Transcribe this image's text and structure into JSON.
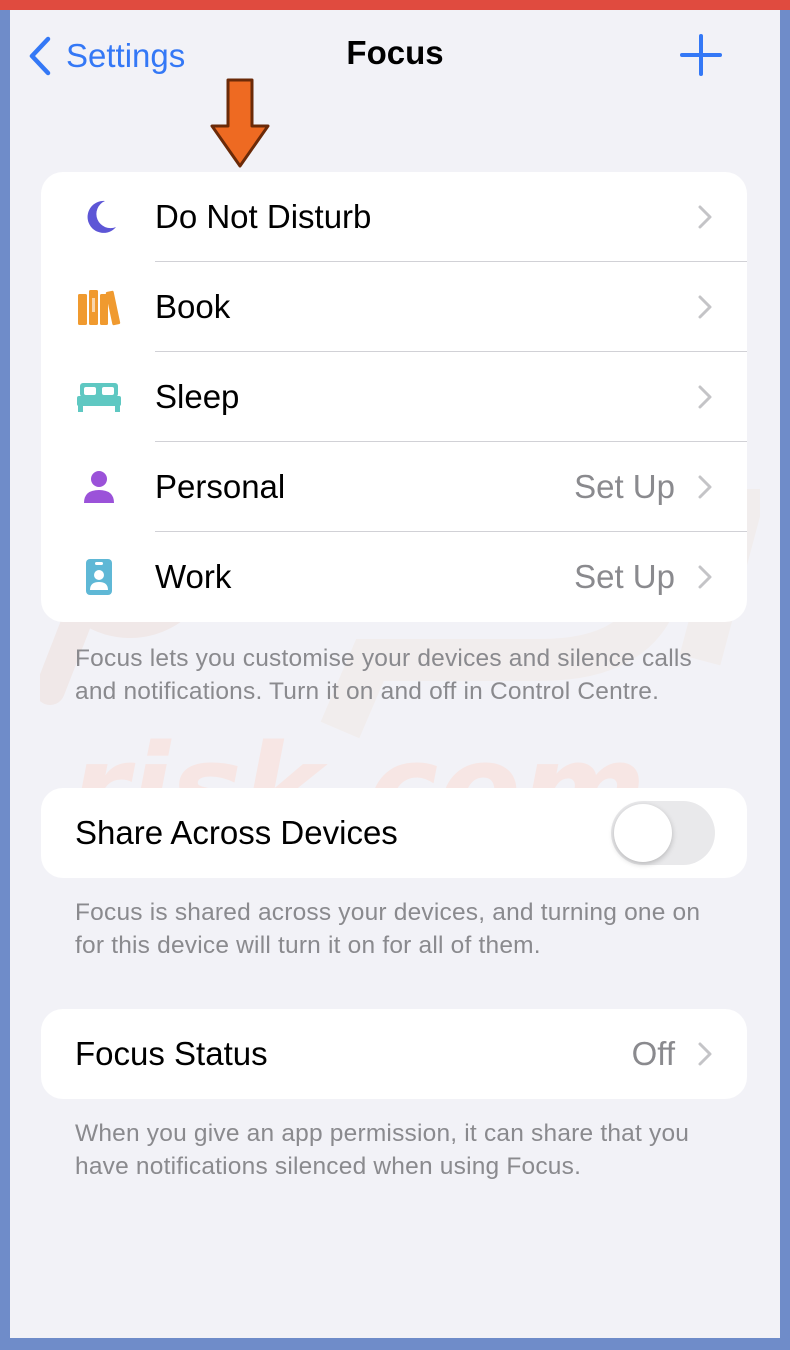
{
  "colors": {
    "accent": "#3478f6",
    "frame": "#6f8cc9",
    "status_strip": "#e04b3f",
    "annotation_arrow": "#ee6a22"
  },
  "nav": {
    "back_label": "Settings",
    "title": "Focus",
    "add_icon": "plus-icon"
  },
  "focus_modes": [
    {
      "label": "Do Not Disturb",
      "icon": "moon-icon",
      "value": "",
      "color": "#5d56d6"
    },
    {
      "label": "Book",
      "icon": "books-icon",
      "value": "",
      "color": "#f09a2f"
    },
    {
      "label": "Sleep",
      "icon": "bed-icon",
      "value": "",
      "color": "#5fc8c2"
    },
    {
      "label": "Personal",
      "icon": "person-icon",
      "value": "Set Up",
      "color": "#9b52d9"
    },
    {
      "label": "Work",
      "icon": "id-badge-icon",
      "value": "Set Up",
      "color": "#5fb8d6"
    }
  ],
  "focus_footnote": "Focus lets you customise your devices and silence calls and notifications. Turn it on and off in Control Centre.",
  "share": {
    "label": "Share Across Devices",
    "enabled": false,
    "footnote": "Focus is shared across your devices, and turning one on for this device will turn it on for all of them."
  },
  "status": {
    "label": "Focus Status",
    "value": "Off",
    "footnote": "When you give an app permission, it can share that you have notifications silenced when using Focus."
  },
  "watermark_text": "risk.com"
}
